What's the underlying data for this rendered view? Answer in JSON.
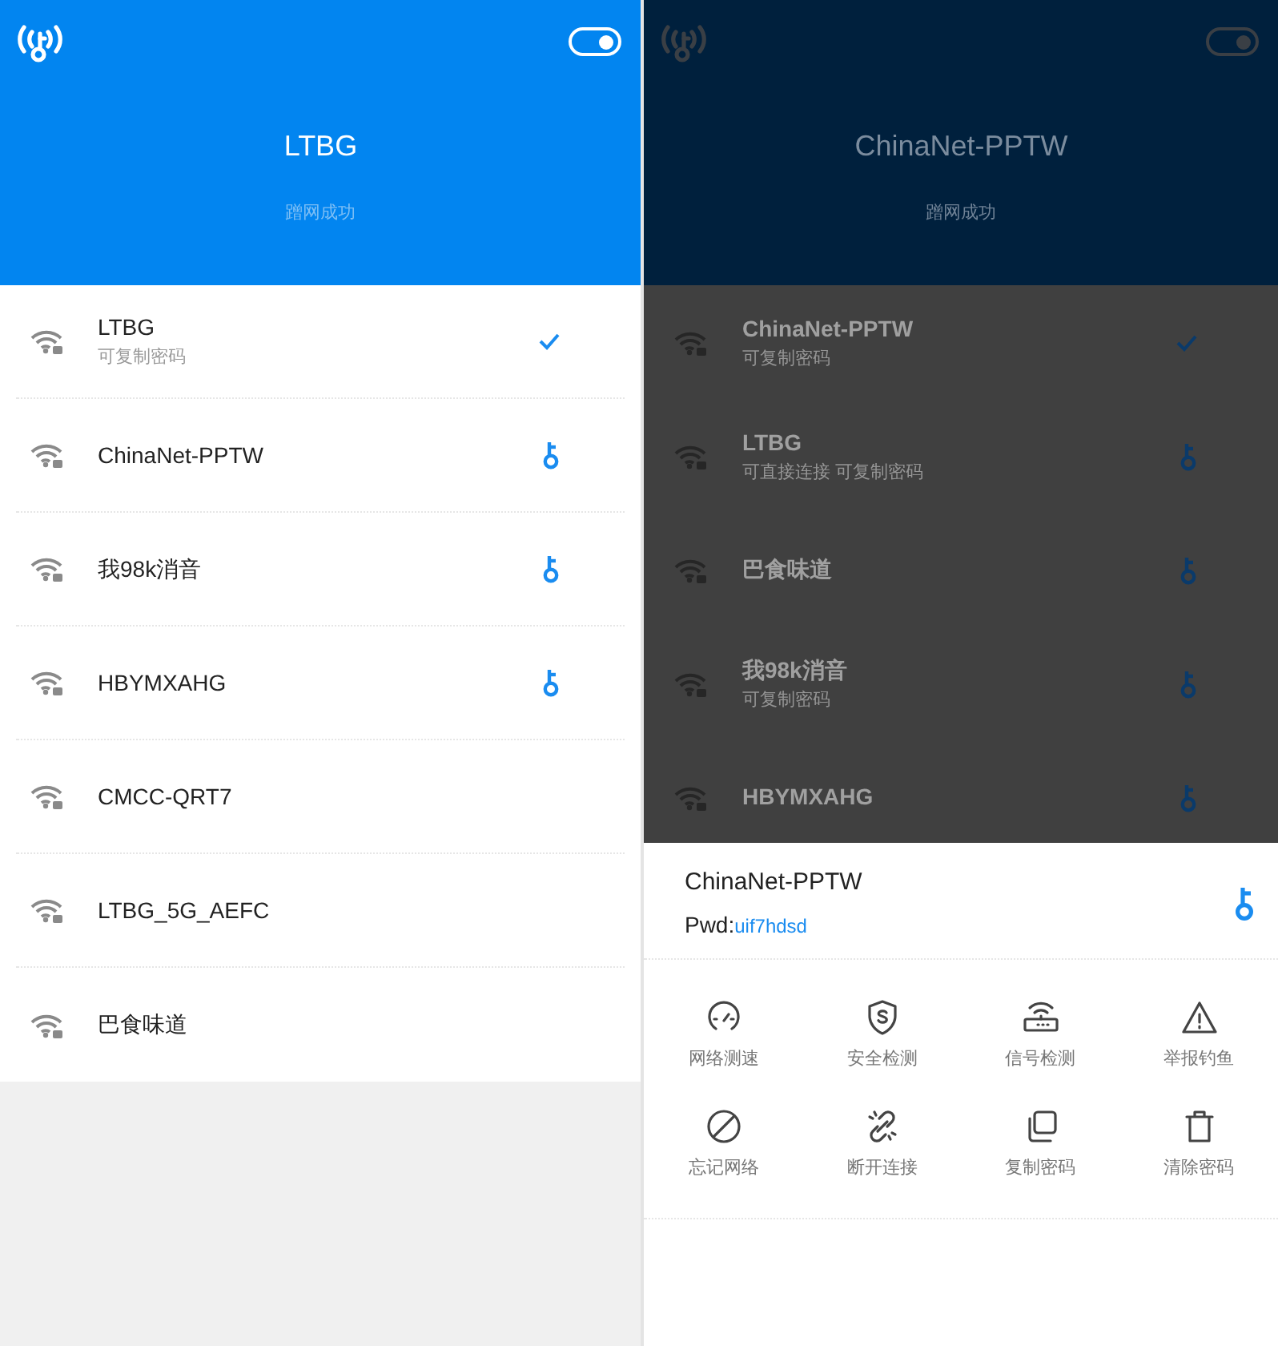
{
  "screens": [
    {
      "dimmed": false,
      "header": {
        "toggle_on": true,
        "title": "LTBG",
        "subtitle": "蹭网成功"
      },
      "networks": [
        {
          "name": "LTBG",
          "note": "可复制密码",
          "kind": "connected"
        },
        {
          "name": "ChinaNet-PPTW",
          "kind": "key"
        },
        {
          "name": "我98k消音",
          "kind": "key"
        },
        {
          "name": "HBYMXAHG",
          "kind": "key"
        },
        {
          "name": "CMCC-QRT7",
          "kind": "open"
        },
        {
          "name": "LTBG_5G_AEFC",
          "kind": "open"
        },
        {
          "name": "巴食味道",
          "kind": "open"
        }
      ]
    },
    {
      "dimmed": true,
      "header": {
        "toggle_on": true,
        "title": "ChinaNet-PPTW",
        "subtitle": "蹭网成功"
      },
      "networks": [
        {
          "name": "ChinaNet-PPTW",
          "note": "可复制密码",
          "kind": "connected"
        },
        {
          "name": "LTBG",
          "note": "可直接连接 可复制密码",
          "kind": "key"
        },
        {
          "name": "巴食味道",
          "kind": "key"
        },
        {
          "name": "我98k消音",
          "note": "可复制密码",
          "kind": "key"
        },
        {
          "name": "HBYMXAHG",
          "kind": "key"
        }
      ],
      "sheet": {
        "network": "ChinaNet-PPTW",
        "password_label": "Pwd:",
        "password": "uif7hdsd",
        "actions": [
          {
            "label": "网络测速",
            "kind": "speed"
          },
          {
            "label": "安全检测",
            "kind": "shield"
          },
          {
            "label": "信号检测",
            "kind": "router"
          },
          {
            "label": "举报钓鱼",
            "kind": "warning"
          },
          {
            "label": "忘记网络",
            "kind": "forbid"
          },
          {
            "label": "断开连接",
            "kind": "unlink"
          },
          {
            "label": "复制密码",
            "kind": "copy"
          },
          {
            "label": "清除密码",
            "kind": "trash"
          }
        ]
      }
    }
  ]
}
